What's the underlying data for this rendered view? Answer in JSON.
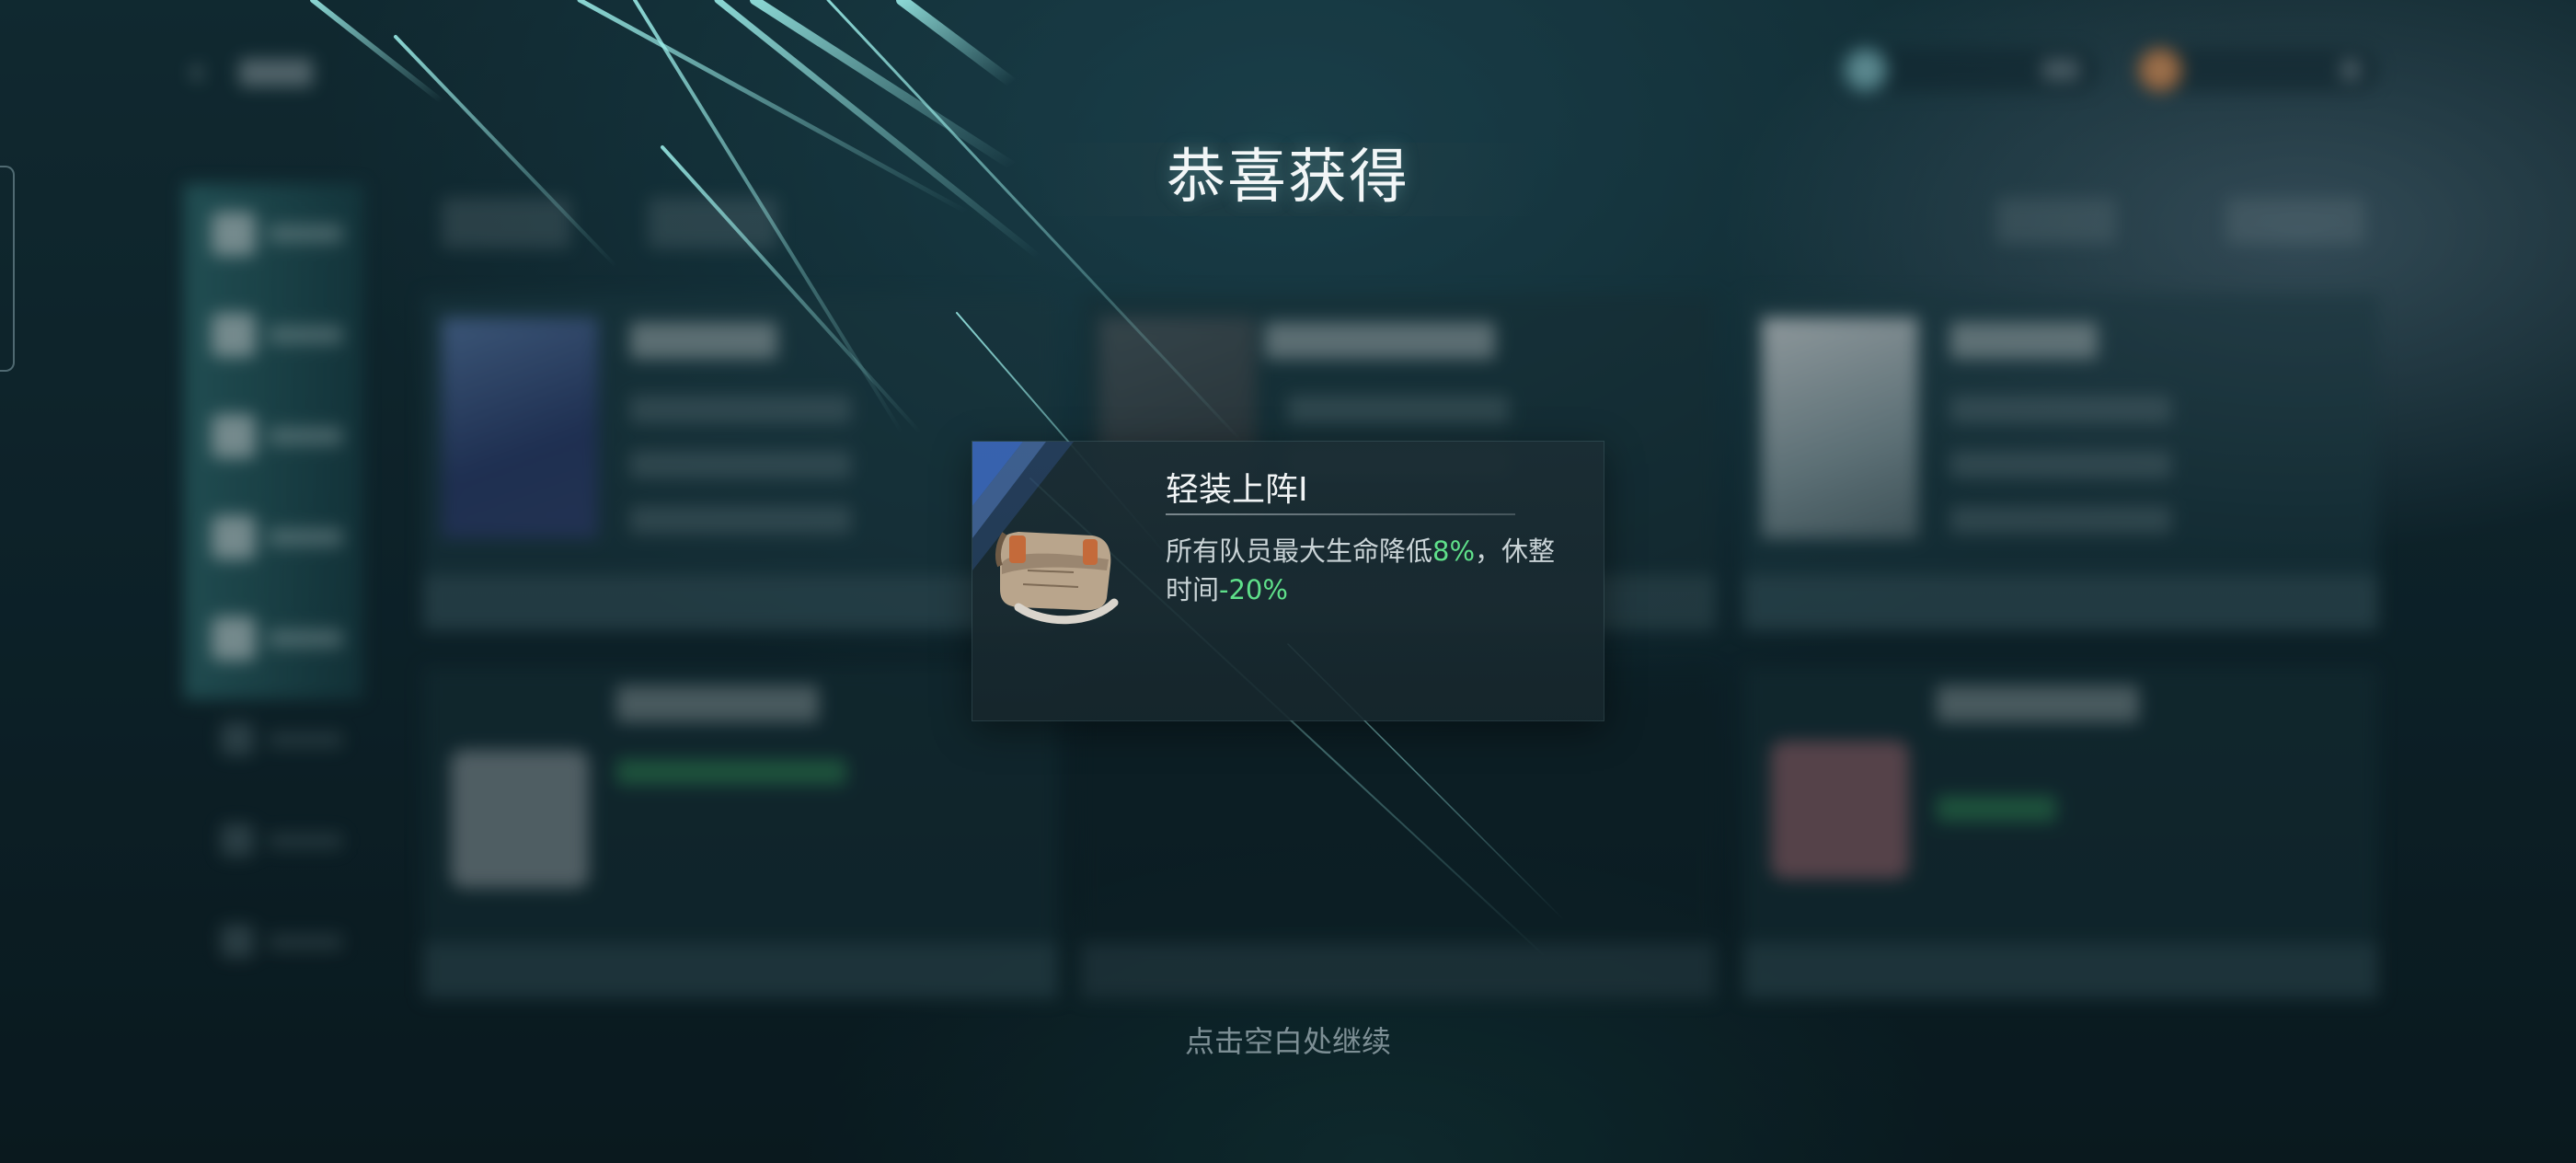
{
  "popup": {
    "title": "恭喜获得",
    "continue_hint": "点击空白处继续"
  },
  "reward": {
    "name": "轻装上阵I",
    "desc_part1": "所有队员最大生命降低",
    "desc_value1": "8%",
    "desc_part2": "，休整时间",
    "desc_value2": "-20%",
    "icon": "shoulder-bag-icon"
  },
  "colors": {
    "highlight_green": "#5fe08a",
    "title_text": "#f2f6f7",
    "hint_text": "#7d8f95"
  }
}
